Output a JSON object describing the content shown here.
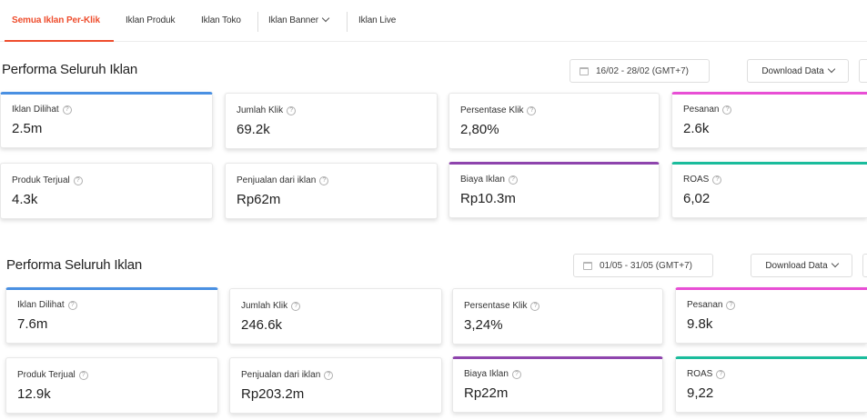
{
  "tabs": [
    {
      "label": "Semua Iklan Per-Klik",
      "active": true
    },
    {
      "label": "Iklan Produk"
    },
    {
      "label": "Iklan Toko"
    },
    {
      "label": "Iklan Banner",
      "dropdown": true
    },
    {
      "label": "Iklan Live"
    }
  ],
  "accent_color": "#ee4d2d",
  "sections": [
    {
      "title": "Performa Seluruh Iklan",
      "date_range": "16/02 - 28/02 (GMT+7)",
      "download_label": "Download Data",
      "metrics": [
        {
          "label": "Iklan Dilihat",
          "value": "2.5m",
          "accent": "#4a90e2"
        },
        {
          "label": "Jumlah Klik",
          "value": "69.2k"
        },
        {
          "label": "Persentase Klik",
          "value": "2,80%"
        },
        {
          "label": "Pesanan",
          "value": "2.6k",
          "accent": "#e84fd5"
        },
        {
          "label": "Produk Terjual",
          "value": "4.3k"
        },
        {
          "label": "Penjualan dari iklan",
          "value": "Rp62m"
        },
        {
          "label": "Biaya Iklan",
          "value": "Rp10.3m",
          "accent": "#8e44ad"
        },
        {
          "label": "ROAS",
          "value": "6,02",
          "accent": "#1abc9c"
        }
      ]
    },
    {
      "title": "Performa Seluruh Iklan",
      "date_range": "01/05 - 31/05 (GMT+7)",
      "download_label": "Download Data",
      "metrics": [
        {
          "label": "Iklan Dilihat",
          "value": "7.6m",
          "accent": "#4a90e2"
        },
        {
          "label": "Jumlah Klik",
          "value": "246.6k"
        },
        {
          "label": "Persentase Klik",
          "value": "3,24%"
        },
        {
          "label": "Pesanan",
          "value": "9.8k",
          "accent": "#e84fd5"
        },
        {
          "label": "Produk Terjual",
          "value": "12.9k"
        },
        {
          "label": "Penjualan dari iklan",
          "value": "Rp203.2m"
        },
        {
          "label": "Biaya Iklan",
          "value": "Rp22m",
          "accent": "#8e44ad"
        },
        {
          "label": "ROAS",
          "value": "9,22",
          "accent": "#1abc9c"
        }
      ]
    }
  ]
}
